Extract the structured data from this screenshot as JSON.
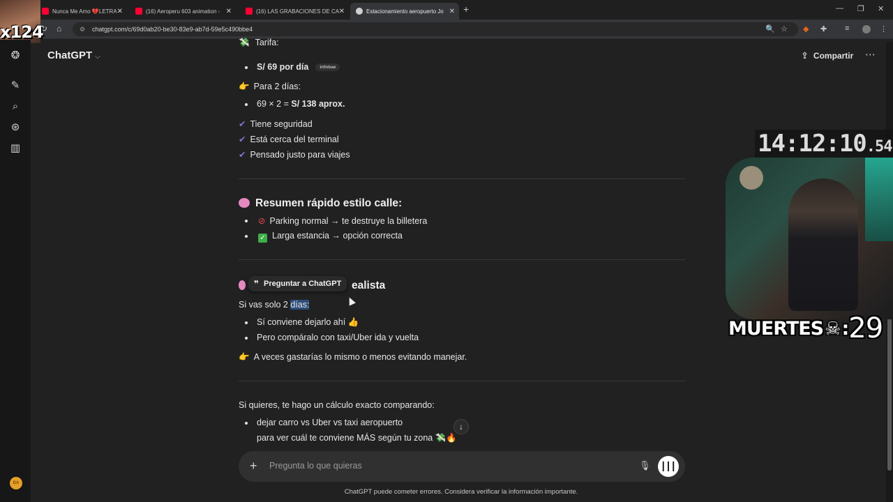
{
  "browser": {
    "tabs": [
      {
        "title": "Nunca Me Amo 💔LETRA -",
        "favicon_color": "#ff0033"
      },
      {
        "title": "(16) Aeroperu 603 animation -",
        "favicon_color": "#ff0033"
      },
      {
        "title": "(16) LAS GRABACIONES DE CA",
        "favicon_color": "#ff0033"
      },
      {
        "title": "Estacionamiento aeropuerto Jo",
        "favicon_color": "#d0d0d0"
      }
    ],
    "url": "chatgpt.com/c/69d0ab20-be30-83e9-ab7d-59e5c490bbe4"
  },
  "overlay": {
    "counter": "x124",
    "clock_main": "14:12:10",
    "clock_ms": ".54",
    "deaths_label": "MUERTES",
    "deaths_sep": ":",
    "deaths_count": "29"
  },
  "header": {
    "app_title": "ChatGPT",
    "share_label": "Compartir"
  },
  "sidebar": {
    "avatar_initials": "DA"
  },
  "chat": {
    "tarifa_label": "Tarifa:",
    "price_line": "S/ 69 por día",
    "source_pill": "infobae",
    "two_days_label": "Para 2 días:",
    "calc_prefix": "69 × 2 = ",
    "calc_result": "S/ 138 aprox.",
    "checks": [
      "Tiene seguridad",
      "Está cerca del terminal",
      "Pensado justo para viajes"
    ],
    "summary_heading": "Resumen rápido estilo calle:",
    "summary_items": [
      "Parking normal → te destruye la billetera",
      "Larga estancia → opción correcta"
    ],
    "realista_heading_tail": "ealista",
    "tooltip_label": "Preguntar a ChatGPT",
    "si_vas_prefix": "Si vas solo 2 ",
    "si_vas_selected": "días:",
    "si_vas_items": [
      "Sí conviene dejarlo ahí 👍",
      "Pero compáralo con taxi/Uber ida y vuelta"
    ],
    "a_veces": "A veces gastarías lo mismo o menos evitando manejar.",
    "si_quieres": "Si quieres, te hago un cálculo exacto comparando:",
    "compare_item": "dejar carro vs Uber vs taxi aeropuerto",
    "compare_item_cont": "para ver cuál te conviene MÁS según tu zona 💸🔥"
  },
  "composer": {
    "placeholder": "Pregunta lo que quieras",
    "disclaimer": "ChatGPT puede cometer errores. Considera verificar la información importante."
  }
}
